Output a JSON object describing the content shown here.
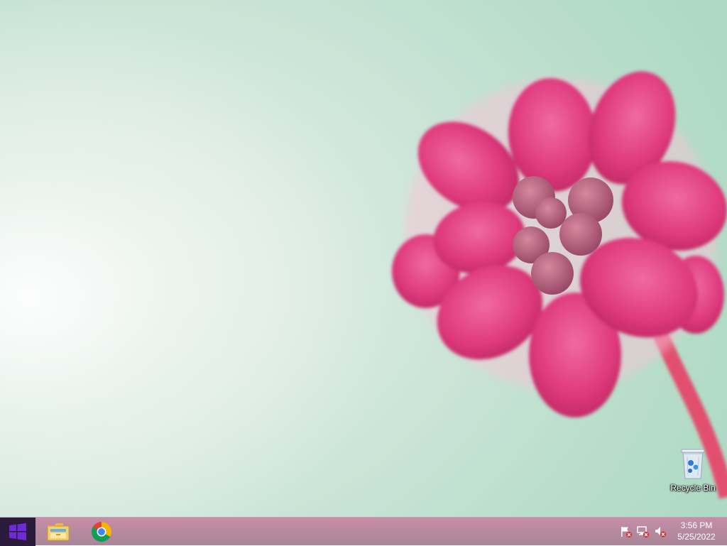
{
  "desktop": {
    "icons": [
      {
        "label": "Recycle Bin",
        "icon": "recycle-bin-icon"
      }
    ]
  },
  "taskbar": {
    "start": {
      "icon": "windows-logo-icon"
    },
    "pinned": [
      {
        "icon": "file-explorer-icon"
      },
      {
        "icon": "chrome-icon"
      }
    ],
    "tray": [
      {
        "icon": "action-center-flag-icon"
      },
      {
        "icon": "network-icon"
      },
      {
        "icon": "volume-muted-icon"
      }
    ],
    "clock": {
      "time": "3:56 PM",
      "date": "5/25/2022"
    }
  },
  "colors": {
    "taskbar": "#b98aa0",
    "start_button": "#2b1b3b",
    "windows_logo": "#6d2ad6",
    "petal": "#e0357a"
  }
}
